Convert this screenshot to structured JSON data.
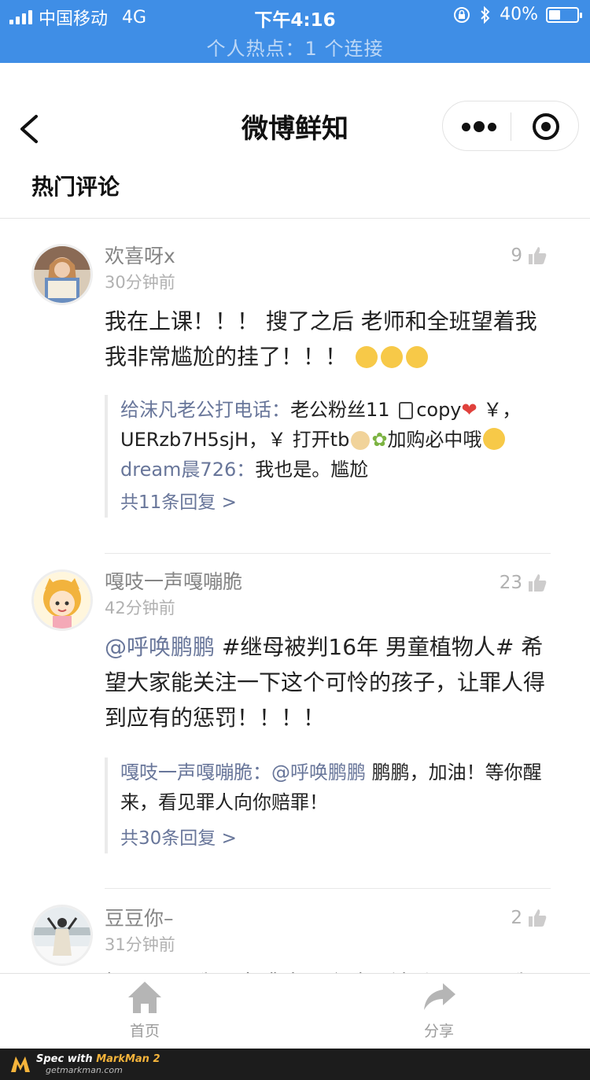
{
  "status_bar": {
    "carrier": "中国移动",
    "network": "4G",
    "time": "下午4:16",
    "battery": "40%",
    "battery_level": 0.4,
    "hotspot": "个人热点：1 个连接",
    "icons": [
      "signal-icon",
      "rotation-lock-icon",
      "bluetooth-icon",
      "battery-icon"
    ]
  },
  "nav": {
    "title": "微博鲜知",
    "section_title": "热门评论",
    "icons": [
      "back-icon",
      "more-dots-icon",
      "target-icon"
    ]
  },
  "comments": [
    {
      "name": "欢喜呀x",
      "time": "30分钟前",
      "likes": "9",
      "text": "我在上课！！！ 搜了之后 老师和全班望着我 我非常尴尬的挂了！！！",
      "emojis": [
        "crying-emoji",
        "crying-emoji",
        "crying-emoji"
      ],
      "replies": [
        {
          "name": "给沫凡老公打电话：",
          "text": "老公粉丝11",
          "text2": "copy",
          "text3": "￥，UERzb7H5sjH，￥ 打开tb",
          "text4": "加购必中哦"
        },
        {
          "name": "dream晨726：",
          "text": "我也是。尴尬"
        }
      ],
      "more": "共11条回复 >"
    },
    {
      "name": "嘎吱一声嘎嘣脆",
      "time": "42分钟前",
      "likes": "23",
      "mention": "@呼唤鹏鹏",
      "text": "#继母被判16年 男童植物人# 希望大家能关注一下这个可怜的孩子，让罪人得到应有的惩罚！！！！",
      "replies": [
        {
          "name": "嘎吱一声嘎嘣脆：@呼唤鹏鹏",
          "text": " 鹏鹏，加油！等你醒来，看见罪人向你赔罪！"
        }
      ],
      "more": "共30条回复 >"
    },
    {
      "name": "豆豆你–",
      "time": "31分钟前",
      "likes": "2",
      "text": "妈呀吓了我一大跳 打开视频后赶紧理了理我的头发"
    }
  ],
  "tabbar": {
    "tabs": [
      {
        "label": "首页",
        "icon": "home-icon"
      },
      {
        "label": "分享",
        "icon": "share-icon"
      }
    ]
  },
  "markman": {
    "title_prefix": "Spec with",
    "title_brand": "MarkMan 2",
    "url": "getmarkman.com"
  },
  "colors": {
    "status_bar": "#3f8ee6",
    "name": "#858585",
    "time": "#b1b1b1",
    "reply_name": "#68769a",
    "reply_border": "#ebebeb"
  }
}
